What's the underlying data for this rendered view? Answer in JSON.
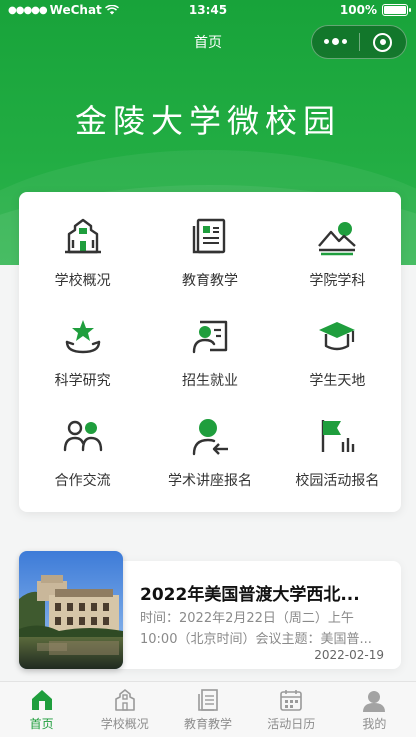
{
  "status_bar": {
    "carrier": "WeChat",
    "time": "13:45",
    "battery": "100%"
  },
  "navbar": {
    "title": "首页"
  },
  "hero": {
    "title": "金陵大学微校园"
  },
  "grid": [
    {
      "label": "学校概况",
      "icon": "school-building-icon"
    },
    {
      "label": "教育教学",
      "icon": "book-icon"
    },
    {
      "label": "学院学科",
      "icon": "landscape-icon"
    },
    {
      "label": "科学研究",
      "icon": "star-hand-icon"
    },
    {
      "label": "招生就业",
      "icon": "person-board-icon"
    },
    {
      "label": "学生天地",
      "icon": "graduation-cap-icon"
    },
    {
      "label": "合作交流",
      "icon": "two-people-icon"
    },
    {
      "label": "学术讲座报名",
      "icon": "person-arrow-icon"
    },
    {
      "label": "校园活动报名",
      "icon": "flag-icon"
    }
  ],
  "news": {
    "title": "2022年美国普渡大学西北...",
    "desc": "时间：2022年2月22日（周二）上午10:00（北京时间）会议主题：美国普...",
    "date": "2022-02-19"
  },
  "tabbar": [
    {
      "label": "首页",
      "icon": "home-icon",
      "active": true
    },
    {
      "label": "学校概况",
      "icon": "school-icon",
      "active": false
    },
    {
      "label": "教育教学",
      "icon": "book-icon",
      "active": false
    },
    {
      "label": "活动日历",
      "icon": "calendar-icon",
      "active": false
    },
    {
      "label": "我的",
      "icon": "user-icon",
      "active": false
    }
  ],
  "colors": {
    "brand_green": "#1f9e3d",
    "icon_dark": "#333333"
  }
}
